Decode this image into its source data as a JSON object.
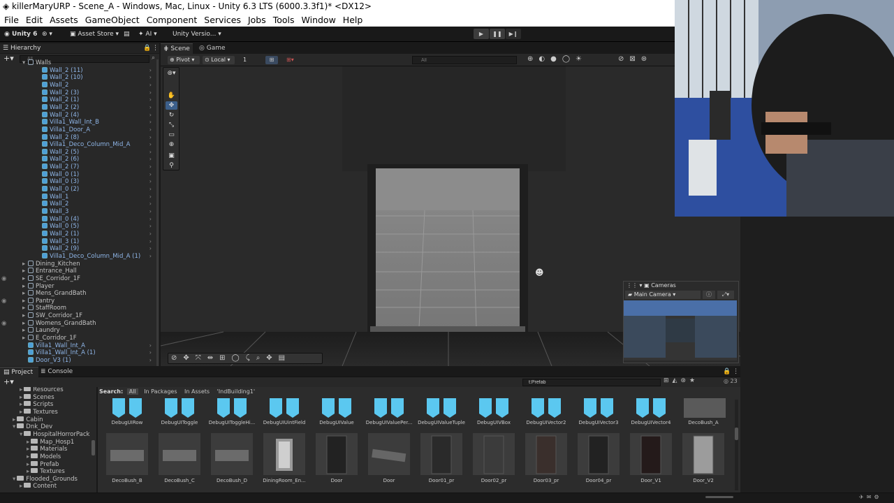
{
  "window": {
    "title": "killerMaryURP - Scene_A - Windows, Mac, Linux - Unity 6.3 LTS (6000.3.3f1)* <DX12>"
  },
  "menu": [
    "File",
    "Edit",
    "Assets",
    "GameObject",
    "Component",
    "Services",
    "Jobs",
    "Tools",
    "Window",
    "Help"
  ],
  "toolbar": {
    "unity": "Unity 6",
    "account_icon": "account-icon",
    "asset_store": "Asset Store",
    "ai": "AI",
    "version_ctrl": "Unity Versio..."
  },
  "hierarchy": {
    "tab": "Hierarchy",
    "search_placeholder": "All",
    "partial_top": "Walls",
    "children": [
      "Wall_2 (11)",
      "Wall_2 (10)",
      "Wall_2",
      "Wall_2 (3)",
      "Wall_2 (1)",
      "Wall_2 (2)",
      "Wall_2 (4)",
      "Villa1_Wall_Int_B",
      "Villa1_Door_A",
      "Wall_2 (8)",
      "Villa1_Deco_Column_Mid_A",
      "Wall_2 (5)",
      "Wall_2 (6)",
      "Wall_2 (7)",
      "Wall_0 (1)",
      "Wall_0 (3)",
      "Wall_0 (2)",
      "Wall_1",
      "Wall_2",
      "Wall_3",
      "Wall_0 (4)",
      "Wall_0 (5)",
      "Wall_2 (1)",
      "Wall_3 (1)",
      "Wall_2 (9)",
      "Villa1_Deco_Column_Mid_A (1)"
    ],
    "groups": [
      "Dining_Kitchen",
      "Entrance_Hall",
      "SE_Corridor_1F",
      "Player",
      "Mens_GrandBath",
      "Pantry",
      "StaffRoom",
      "SW_Corridor_1F",
      "Womens_GrandBath",
      "Laundry",
      "E_Corridor_1F"
    ],
    "tail": [
      "Villa1_Wall_Int_A",
      "Villa1_Wall_Int_A (1)",
      "Door_V3 (1)"
    ]
  },
  "scene": {
    "tabs": [
      "Scene",
      "Game"
    ],
    "pivot": "Pivot",
    "local": "Local",
    "grid_value": "1",
    "search_placeholder": "All"
  },
  "cameras_overlay": {
    "title": "Cameras",
    "selected": "Main Camera"
  },
  "project": {
    "tabs": [
      "Project",
      "Console"
    ],
    "search_value": "t:Prefab",
    "count": "23",
    "filter_label": "Search:",
    "filters": [
      "All",
      "In Packages",
      "In Assets",
      "'IndBuilding1'"
    ],
    "tree": [
      {
        "label": "Resources",
        "indent": 2
      },
      {
        "label": "Scenes",
        "indent": 2
      },
      {
        "label": "Scripts",
        "indent": 2
      },
      {
        "label": "Textures",
        "indent": 2
      },
      {
        "label": "Cabin",
        "indent": 1
      },
      {
        "label": "Dnk_Dev",
        "indent": 1
      },
      {
        "label": "HospitalHorrorPack",
        "indent": 2
      },
      {
        "label": "Map_Hosp1",
        "indent": 3
      },
      {
        "label": "Materials",
        "indent": 3
      },
      {
        "label": "Models",
        "indent": 3
      },
      {
        "label": "Prefab",
        "indent": 3
      },
      {
        "label": "Textures",
        "indent": 3
      },
      {
        "label": "Flooded_Grounds",
        "indent": 1
      },
      {
        "label": "Content",
        "indent": 2
      }
    ],
    "row1": [
      "DebugUIRow",
      "DebugUIToggle",
      "DebugUIToggleHi...",
      "DebugUIUintField",
      "DebugUIValue",
      "DebugUIValuePer...",
      "DebugUIValueTuple",
      "DebugUIVBox",
      "DebugUIVector2",
      "DebugUIVector3",
      "DebugUIVector4",
      "DecoBush_A"
    ],
    "row2": [
      "DecoBush_B",
      "DecoBush_C",
      "DecoBush_D",
      "DiningRoom_En...",
      "Door",
      "Door",
      "Door01_pr",
      "Door02_pr",
      "Door03_pr",
      "Door04_pr",
      "Door_V1",
      "Door_V2"
    ]
  },
  "colors": {
    "accent_blue": "#4fc3f7",
    "selection": "#2c5d87"
  }
}
